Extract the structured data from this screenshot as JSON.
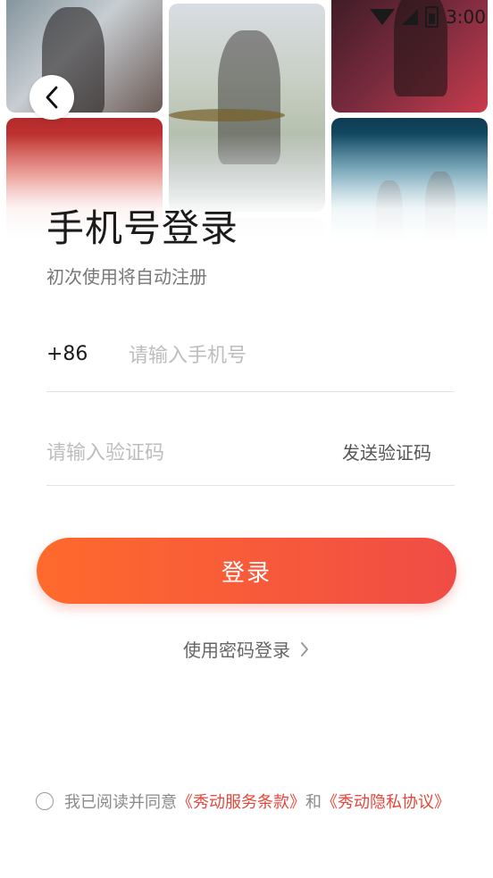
{
  "status_bar": {
    "time": "3:00"
  },
  "header": {
    "title": "手机号登录",
    "subtitle": "初次使用将自动注册"
  },
  "form": {
    "country_code": "+86",
    "phone_placeholder": "请输入手机号",
    "code_placeholder": "请输入验证码",
    "send_code_label": "发送验证码"
  },
  "actions": {
    "login_label": "登录",
    "password_login_label": "使用密码登录"
  },
  "agreement": {
    "prefix": "我已阅读并同意",
    "terms_link": "《秀动服务条款》",
    "conjunction": "和",
    "privacy_link": "《秀动隐私协议》"
  },
  "colors": {
    "accent_start": "#ff6a2c",
    "accent_end": "#f04c46",
    "link": "#e6463a"
  },
  "icons": {
    "back": "chevron-left-icon",
    "password_login": "chevron-right-icon",
    "wifi": "wifi-icon",
    "signal": "signal-icon",
    "battery": "battery-icon"
  }
}
